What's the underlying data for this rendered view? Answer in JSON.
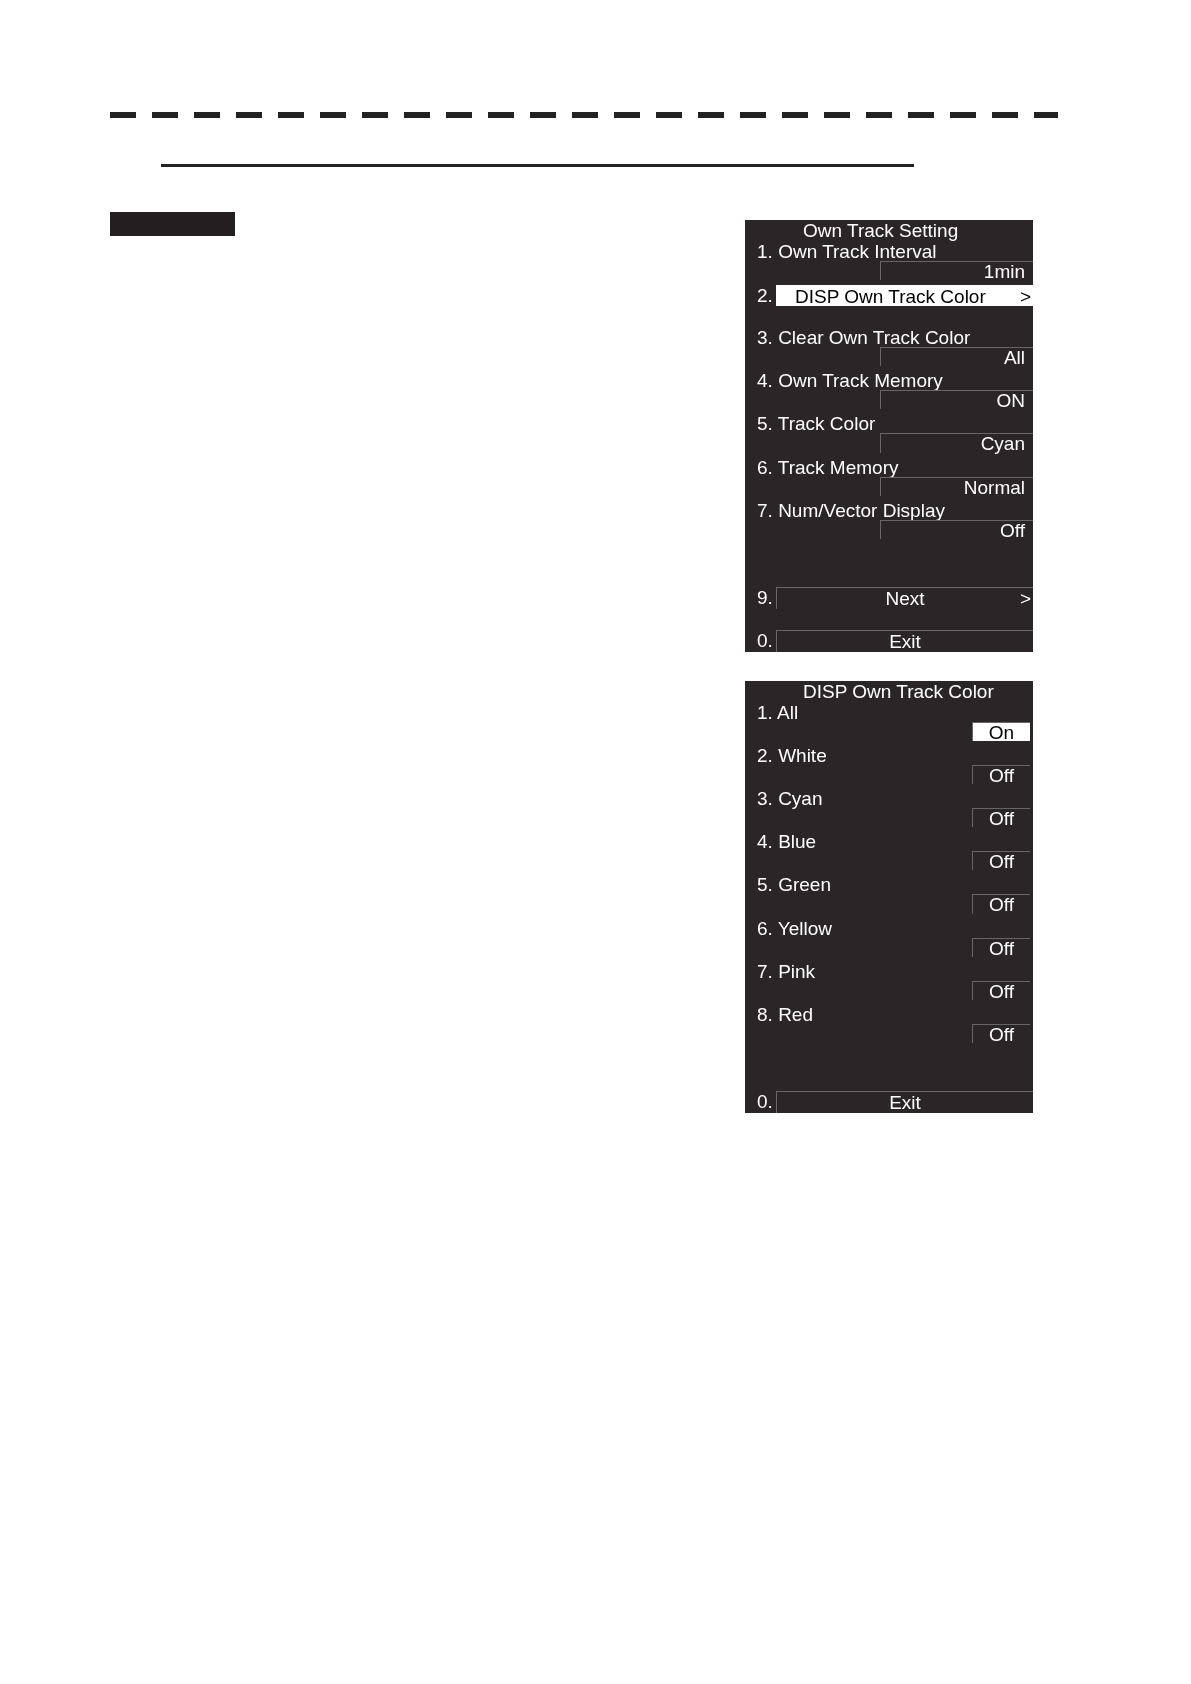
{
  "menus": [
    {
      "title": "Own Track Setting",
      "items": [
        {
          "kind": "value",
          "number": "1.",
          "label": "Own Track Interval",
          "value": "1min",
          "selected": false
        },
        {
          "kind": "submenu",
          "number": "2.",
          "text": "DISP Own Track Color",
          "arrow": ">",
          "selected": true
        },
        {
          "kind": "value",
          "number": "3.",
          "label": "Clear Own Track Color",
          "value": "All",
          "selected": false
        },
        {
          "kind": "value",
          "number": "4.",
          "label": "Own Track Memory",
          "value": "ON",
          "selected": false
        },
        {
          "kind": "value",
          "number": "5.",
          "label": "Track Color",
          "value": "Cyan",
          "selected": false
        },
        {
          "kind": "value",
          "number": "6.",
          "label": "Track Memory",
          "value": "Normal",
          "selected": false
        },
        {
          "kind": "value",
          "number": "7.",
          "label": "Num/Vector Display",
          "value": "Off",
          "selected": false
        },
        {
          "kind": "button",
          "number": "9.",
          "text": "Next",
          "arrow": ">",
          "selected": false
        },
        {
          "kind": "button",
          "number": "0.",
          "text": "Exit",
          "selected": false
        }
      ]
    },
    {
      "title": "DISP Own Track Color",
      "items": [
        {
          "kind": "toggle",
          "number": "1.",
          "label": "All",
          "value": "On",
          "selected": true
        },
        {
          "kind": "toggle",
          "number": "2.",
          "label": "White",
          "value": "Off",
          "selected": false
        },
        {
          "kind": "toggle",
          "number": "3.",
          "label": "Cyan",
          "value": "Off",
          "selected": false
        },
        {
          "kind": "toggle",
          "number": "4.",
          "label": "Blue",
          "value": "Off",
          "selected": false
        },
        {
          "kind": "toggle",
          "number": "5.",
          "label": "Green",
          "value": "Off",
          "selected": false
        },
        {
          "kind": "toggle",
          "number": "6.",
          "label": "Yellow",
          "value": "Off",
          "selected": false
        },
        {
          "kind": "toggle",
          "number": "7.",
          "label": "Pink",
          "value": "Off",
          "selected": false
        },
        {
          "kind": "toggle",
          "number": "8.",
          "label": "Red",
          "value": "Off",
          "selected": false
        },
        {
          "kind": "button",
          "number": "0.",
          "text": "Exit",
          "selected": false
        }
      ]
    }
  ]
}
